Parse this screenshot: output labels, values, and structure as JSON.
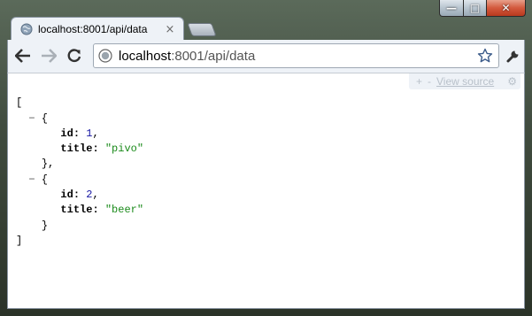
{
  "window": {
    "minimize_glyph": "—",
    "maximize_glyph": "□",
    "close_glyph": "✕"
  },
  "tab": {
    "title": "localhost:8001/api/data",
    "close_glyph": "×"
  },
  "omnibox": {
    "host": "localhost",
    "path": ":8001/api/data"
  },
  "viewer": {
    "plus": "+",
    "minus": "-",
    "view_source": "View source",
    "cog_glyph": "⚙"
  },
  "json": {
    "open_bracket": "[",
    "close_bracket": "]",
    "toggle_glyph": "−",
    "items": [
      {
        "id_key": "id",
        "id_value": "1",
        "title_key": "title",
        "title_value": "\"pivo\"",
        "close": "},"
      },
      {
        "id_key": "id",
        "id_value": "2",
        "title_key": "title",
        "title_value": "\"beer\"",
        "close": "}"
      }
    ]
  },
  "colors": {
    "number": "#1515a3",
    "string": "#1a8a1a",
    "chrome": "#eef2f7"
  },
  "icons": [
    "back-arrow-icon",
    "forward-arrow-icon",
    "reload-icon",
    "globe-icon",
    "star-icon",
    "wrench-icon",
    "gear-icon"
  ]
}
